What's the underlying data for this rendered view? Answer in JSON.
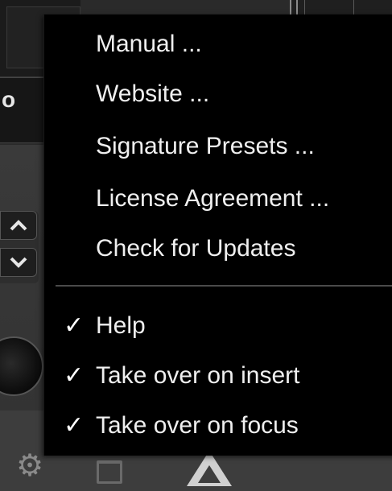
{
  "menu": {
    "items": [
      {
        "label": "Manual ...",
        "checked": false
      },
      {
        "label": "Website ...",
        "checked": false
      },
      {
        "label": "Signature Presets ...",
        "checked": false
      },
      {
        "label": "License Agreement ...",
        "checked": false
      },
      {
        "label": "Check for Updates",
        "checked": false
      }
    ],
    "toggles": [
      {
        "label": "Help",
        "checked": true,
        "check_glyph": "✓"
      },
      {
        "label": "Take over on insert",
        "checked": true,
        "check_glyph": "✓"
      },
      {
        "label": "Take over on focus",
        "checked": true,
        "check_glyph": "✓"
      }
    ]
  },
  "background": {
    "partial_label": "o",
    "icons": [
      "chevron-up-icon",
      "chevron-down-icon",
      "gear-icon",
      "cart-icon",
      "triangle-logo-icon"
    ]
  },
  "colors": {
    "menu_bg": "#000000",
    "menu_text": "#efefef",
    "separator": "#4a4a4a"
  }
}
